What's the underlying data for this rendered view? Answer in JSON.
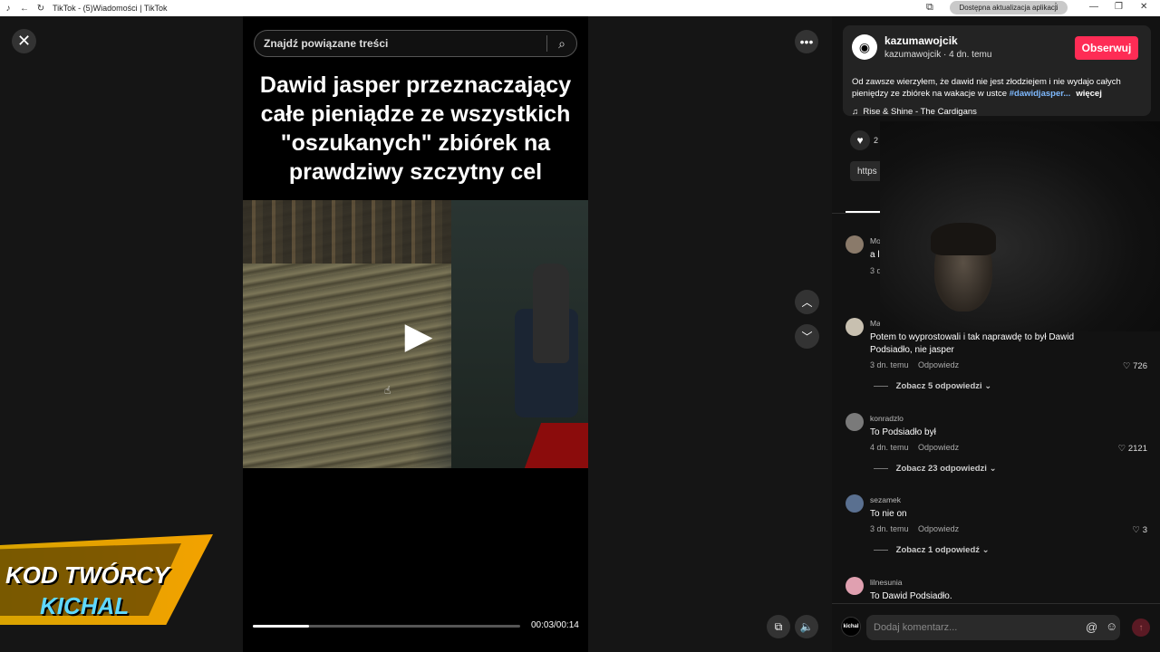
{
  "browser": {
    "title": "TikTok - (5)Wiadomości | TikTok",
    "update_label": "Dostępna aktualizacja aplikacji"
  },
  "search": {
    "placeholder": "Znajdź powiązane treści"
  },
  "video": {
    "caption": "Dawid jasper przeznaczający całe pieniądze ze wszystkich \"oszukanych\" zbiórek na prawdziwy szczytny cel",
    "time": "00:03/00:14",
    "progress_fraction": 0.21
  },
  "promo": {
    "line1": "KOD TWÓRCY",
    "line2": "KICHAL"
  },
  "author": {
    "display_name": "kazumawojcik",
    "handle": "kazumawojcik",
    "time_ago": "· 4 dn. temu",
    "follow_label": "Obserwuj",
    "description": "Od zawsze wierzyłem, że dawid nie jest złodziejem i nie wydajo całych pieniędzy ze zbiórek na wakacje w ustce ",
    "hashtag": "#dawidjasper...",
    "more_label": "więcej",
    "music": "Rise & Shine - The Cardigans"
  },
  "stats": {
    "likes_partial": "2",
    "link_partial": "https"
  },
  "comments": [
    {
      "user": "Mo",
      "text": "a l",
      "time": "3 d",
      "reply_label": "",
      "likes": "",
      "replies": "",
      "avatar_color": "#8a7a6a"
    },
    {
      "user": "Ma",
      "text": "Potem to wyprostowali i tak naprawdę to był Dawid Podsiadło, nie jasper",
      "time": "3 dn. temu",
      "reply_label": "Odpowiedz",
      "likes": "726",
      "replies": "Zobacz 5 odpowiedzi",
      "avatar_color": "#c8c0b0"
    },
    {
      "user": "konradzlo",
      "text": "To Podsiadło był",
      "time": "4 dn. temu",
      "reply_label": "Odpowiedz",
      "likes": "2121",
      "replies": "Zobacz 23 odpowiedzi",
      "avatar_color": "#7a7a7a"
    },
    {
      "user": "sezamek",
      "text": "To nie on",
      "time": "3 dn. temu",
      "reply_label": "Odpowiedz",
      "likes": "3",
      "replies": "Zobacz 1 odpowiedź",
      "avatar_color": "#5a7090"
    },
    {
      "user": "lilnesunia",
      "text": "To Dawid Podsiadło.",
      "time": "",
      "reply_label": "",
      "likes": "",
      "replies": "",
      "avatar_color": "#e0a0b0"
    }
  ],
  "comment_bar": {
    "avatar_text": "kichal",
    "placeholder": "Dodaj komentarz..."
  },
  "icons": {
    "close": "close-icon",
    "more": "more-icon",
    "search": "search-icon",
    "play": "play-icon",
    "up": "chevron-up-icon",
    "down": "chevron-down-icon",
    "volume": "volume-icon",
    "pip": "picture-in-picture-icon",
    "heart": "heart-icon",
    "music": "music-note-icon"
  },
  "colors": {
    "accent": "#fe2c55",
    "hashtag": "#7fbaff",
    "promo_cyan": "#5fd8ff",
    "promo_yellow": "#f3a200"
  }
}
